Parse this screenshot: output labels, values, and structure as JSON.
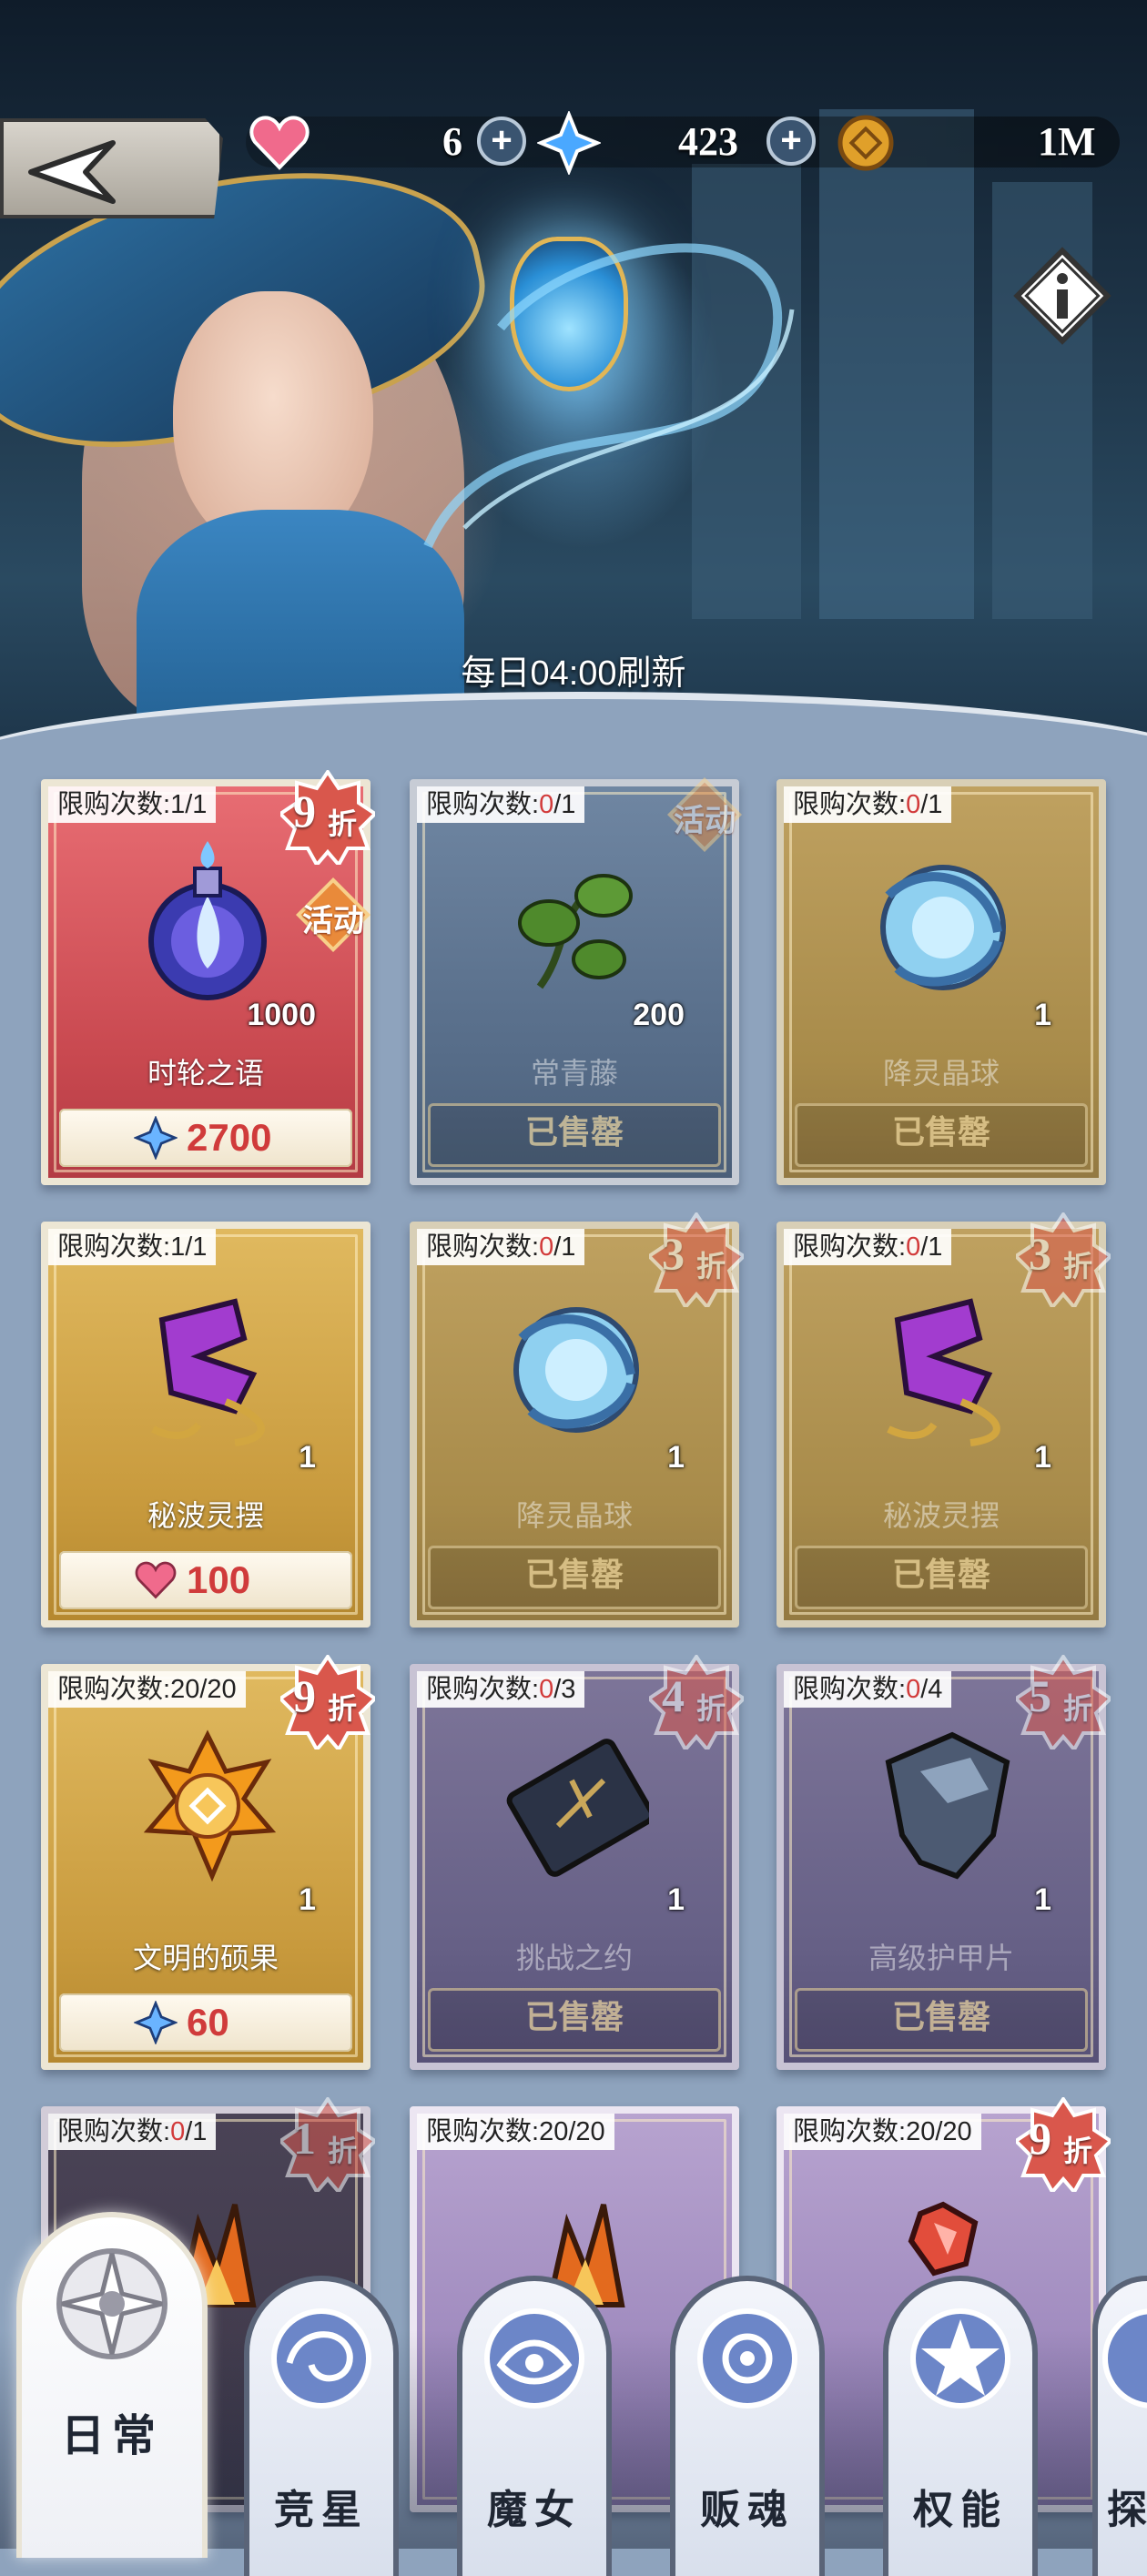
{
  "header": {
    "resources": [
      {
        "icon": "heart-icon",
        "value": "6",
        "color": "#f06a8c"
      },
      {
        "icon": "blue-crystal-icon",
        "value": "423",
        "color": "#4aa8ff"
      },
      {
        "icon": "gold-coin-icon",
        "value": "1M",
        "color": "#e0a02a"
      }
    ],
    "refresh_text": "每日04:00刷新"
  },
  "items": [
    {
      "limit_label": "限购次数:",
      "limit_cur": "1",
      "limit_max": "/1",
      "name": "时轮之语",
      "qty": "1000",
      "discount_num": "9",
      "discount_suffix": "折",
      "event_label": "活动",
      "price_icon": "blue-crystal-icon",
      "price": "2700",
      "sold": false,
      "style": "red",
      "art": "purple-flame-orb"
    },
    {
      "limit_label": "限购次数:",
      "limit_cur": "0",
      "limit_max": "/1",
      "name": "常青藤",
      "qty": "200",
      "discount_num": "",
      "discount_suffix": "",
      "event_label": "活动",
      "price": "",
      "sold_label": "已售罄",
      "sold": true,
      "style": "bluesold",
      "art": "ivy"
    },
    {
      "limit_label": "限购次数:",
      "limit_cur": "0",
      "limit_max": "/1",
      "name": "降灵晶球",
      "qty": "1",
      "discount_num": "",
      "discount_suffix": "",
      "event_label": "",
      "price": "",
      "sold_label": "已售罄",
      "sold": true,
      "style": "goldsold",
      "art": "crystal-ball"
    },
    {
      "limit_label": "限购次数:",
      "limit_cur": "1",
      "limit_max": "/1",
      "name": "秘波灵摆",
      "qty": "1",
      "discount_num": "",
      "discount_suffix": "",
      "event_label": "",
      "price_icon": "heart-icon",
      "price": "100",
      "sold": false,
      "style": "gold",
      "art": "pendulum"
    },
    {
      "limit_label": "限购次数:",
      "limit_cur": "0",
      "limit_max": "/1",
      "name": "降灵晶球",
      "qty": "1",
      "discount_num": "3",
      "discount_suffix": "折",
      "event_label": "",
      "price": "",
      "sold_label": "已售罄",
      "sold": true,
      "style": "goldsold",
      "art": "crystal-ball"
    },
    {
      "limit_label": "限购次数:",
      "limit_cur": "0",
      "limit_max": "/1",
      "name": "秘波灵摆",
      "qty": "1",
      "discount_num": "3",
      "discount_suffix": "折",
      "event_label": "",
      "price": "",
      "sold_label": "已售罄",
      "sold": true,
      "style": "goldsold",
      "art": "pendulum"
    },
    {
      "limit_label": "限购次数:",
      "limit_cur": "20",
      "limit_max": "/20",
      "name": "文明的硕果",
      "qty": "1",
      "discount_num": "9",
      "discount_suffix": "折",
      "event_label": "",
      "price_icon": "blue-crystal-icon",
      "price": "60",
      "sold": false,
      "style": "gold",
      "art": "orange-flower"
    },
    {
      "limit_label": "限购次数:",
      "limit_cur": "0",
      "limit_max": "/3",
      "name": "挑战之约",
      "qty": "1",
      "discount_num": "4",
      "discount_suffix": "折",
      "event_label": "",
      "price": "",
      "sold_label": "已售罄",
      "sold": true,
      "style": "purpsold",
      "art": "ticket"
    },
    {
      "limit_label": "限购次数:",
      "limit_cur": "0",
      "limit_max": "/4",
      "name": "高级护甲片",
      "qty": "1",
      "discount_num": "5",
      "discount_suffix": "折",
      "event_label": "",
      "price": "",
      "sold_label": "已售罄",
      "sold": true,
      "style": "purpsold",
      "art": "armor"
    },
    {
      "limit_label": "限购次数:",
      "limit_cur": "0",
      "limit_max": "/1",
      "name": "",
      "qty": "",
      "discount_num": "1",
      "discount_suffix": "折",
      "event_label": "",
      "price": "",
      "sold": true,
      "style": "dark",
      "art": "fire-crystal"
    },
    {
      "limit_label": "限购次数:",
      "limit_cur": "20",
      "limit_max": "/20",
      "name": "",
      "qty": "",
      "discount_num": "",
      "discount_suffix": "",
      "event_label": "",
      "price": "",
      "sold": false,
      "style": "purp",
      "art": "fire-crystal"
    },
    {
      "limit_label": "限购次数:",
      "limit_cur": "20",
      "limit_max": "/20",
      "name": "",
      "qty": "",
      "discount_num": "9",
      "discount_suffix": "折",
      "event_label": "",
      "price": "",
      "sold": false,
      "style": "purp",
      "art": "red-gem"
    }
  ],
  "tabs": [
    {
      "label": "日常",
      "active": true,
      "icon": "compass-star-icon"
    },
    {
      "label": "竞星",
      "active": false,
      "icon": "swirl-emblem-icon"
    },
    {
      "label": "魔女",
      "active": false,
      "icon": "witch-emblem-icon"
    },
    {
      "label": "贩魂",
      "active": false,
      "icon": "soul-emblem-icon"
    },
    {
      "label": "权能",
      "active": false,
      "icon": "star-emblem-icon"
    },
    {
      "label": "探",
      "active": false,
      "icon": "explore-emblem-icon"
    }
  ],
  "colors": {
    "price_red": "#d03b3b",
    "zero_red": "#d23b3b",
    "discount_bg": "#d9574c"
  }
}
